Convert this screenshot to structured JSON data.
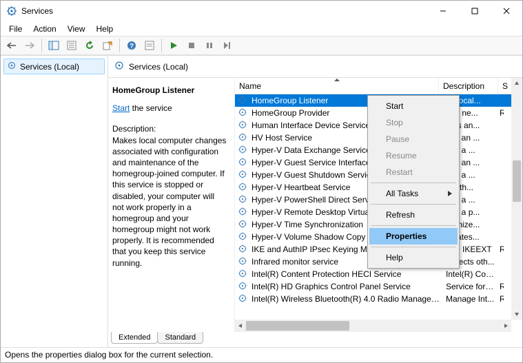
{
  "titlebar": {
    "title": "Services"
  },
  "menubar": {
    "file": "File",
    "action": "Action",
    "view": "View",
    "help": "Help"
  },
  "nav": {
    "item": "Services (Local)"
  },
  "content_header": "Services (Local)",
  "detail": {
    "name": "HomeGroup Listener",
    "start_link": "Start",
    "start_suffix": " the service",
    "desc_label": "Description:",
    "desc_text": "Makes local computer changes associated with configuration and maintenance of the homegroup-joined computer. If this service is stopped or disabled, your computer will not work properly in a homegroup and your homegroup might not work properly. It is recommended that you keep this service running."
  },
  "columns": {
    "name": "Name",
    "description": "Description",
    "startup": "S"
  },
  "services": [
    {
      "name": "HomeGroup Listener",
      "desc": "es local...",
      "start": ""
    },
    {
      "name": "HomeGroup Provider",
      "desc": "rms ne...",
      "start": "R"
    },
    {
      "name": "Human Interface Device Service",
      "desc": "ates an...",
      "start": ""
    },
    {
      "name": "HV Host Service",
      "desc": "des an ...",
      "start": ""
    },
    {
      "name": "Hyper-V Data Exchange Service",
      "desc": "des a ...",
      "start": ""
    },
    {
      "name": "Hyper-V Guest Service Interface",
      "desc": "des an ...",
      "start": ""
    },
    {
      "name": "Hyper-V Guest Shutdown Service",
      "desc": "des a ...",
      "start": ""
    },
    {
      "name": "Hyper-V Heartbeat Service",
      "desc": "ors th...",
      "start": ""
    },
    {
      "name": "Hyper-V PowerShell Direct Service",
      "desc": "des a ...",
      "start": ""
    },
    {
      "name": "Hyper-V Remote Desktop Virtualization",
      "desc": "des a p...",
      "start": ""
    },
    {
      "name": "Hyper-V Time Synchronization",
      "desc": "nronize...",
      "start": ""
    },
    {
      "name": "Hyper-V Volume Shadow Copy",
      "desc": "dinates...",
      "start": ""
    },
    {
      "name": "IKE and AuthIP IPsec Keying Modules",
      "desc": "The IKEEXT",
      "start": "R"
    },
    {
      "name": "Infrared monitor service",
      "desc": "Detects oth...",
      "start": ""
    },
    {
      "name": "Intel(R) Content Protection HECI Service",
      "desc": "Intel(R) Con...",
      "start": ""
    },
    {
      "name": "Intel(R) HD Graphics Control Panel Service",
      "desc": "Service for I...",
      "start": "R"
    },
    {
      "name": "Intel(R) Wireless Bluetooth(R) 4.0 Radio Management",
      "desc": "Manage Int...",
      "start": "R"
    }
  ],
  "context_menu": {
    "start": "Start",
    "stop": "Stop",
    "pause": "Pause",
    "resume": "Resume",
    "restart": "Restart",
    "all_tasks": "All Tasks",
    "refresh": "Refresh",
    "properties": "Properties",
    "help": "Help"
  },
  "tabs": {
    "extended": "Extended",
    "standard": "Standard"
  },
  "statusbar": "Opens the properties dialog box for the current selection."
}
